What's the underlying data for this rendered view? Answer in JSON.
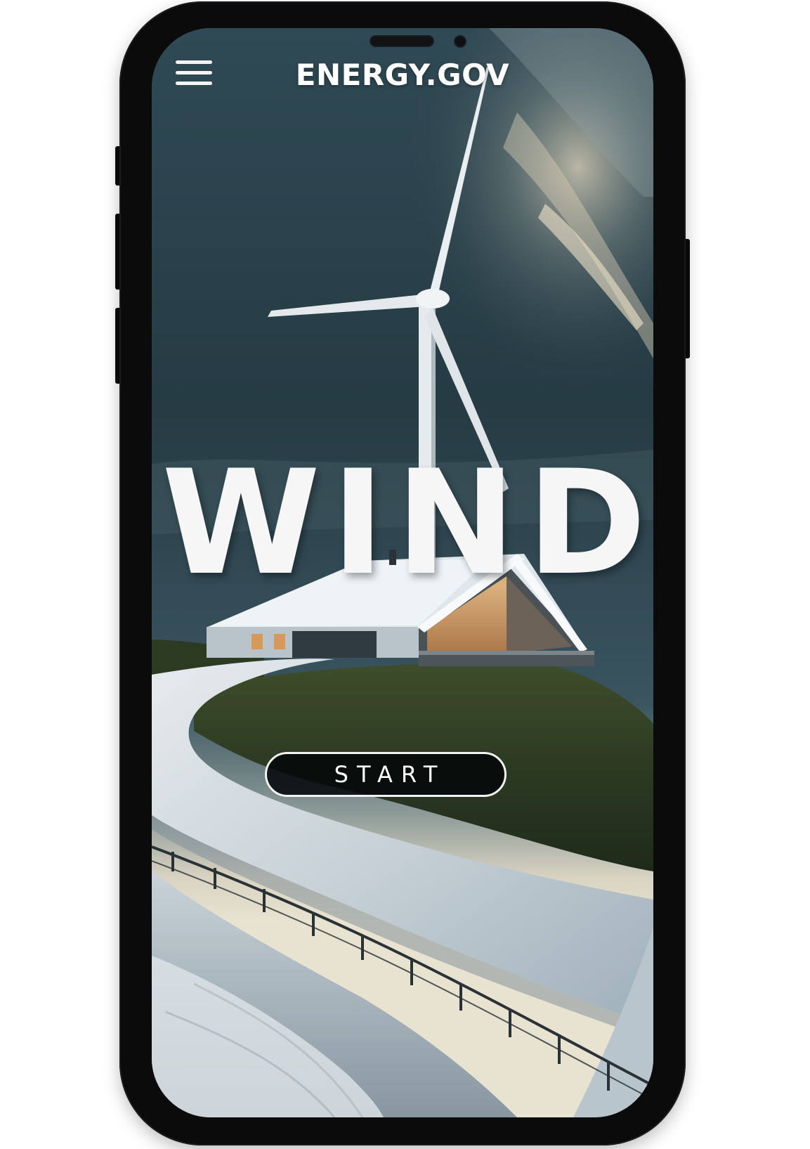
{
  "app": {
    "brand": "ENERGY.GOV",
    "hero_title_letters": [
      "W",
      "I",
      "N",
      "D"
    ],
    "start_label": "START"
  },
  "icons": {
    "menu": "hamburger-menu-icon"
  },
  "colors": {
    "frame": "#0b0b0c",
    "sky": "#2b3d45",
    "text": "#ffffff",
    "button_fill": "#05080a"
  }
}
